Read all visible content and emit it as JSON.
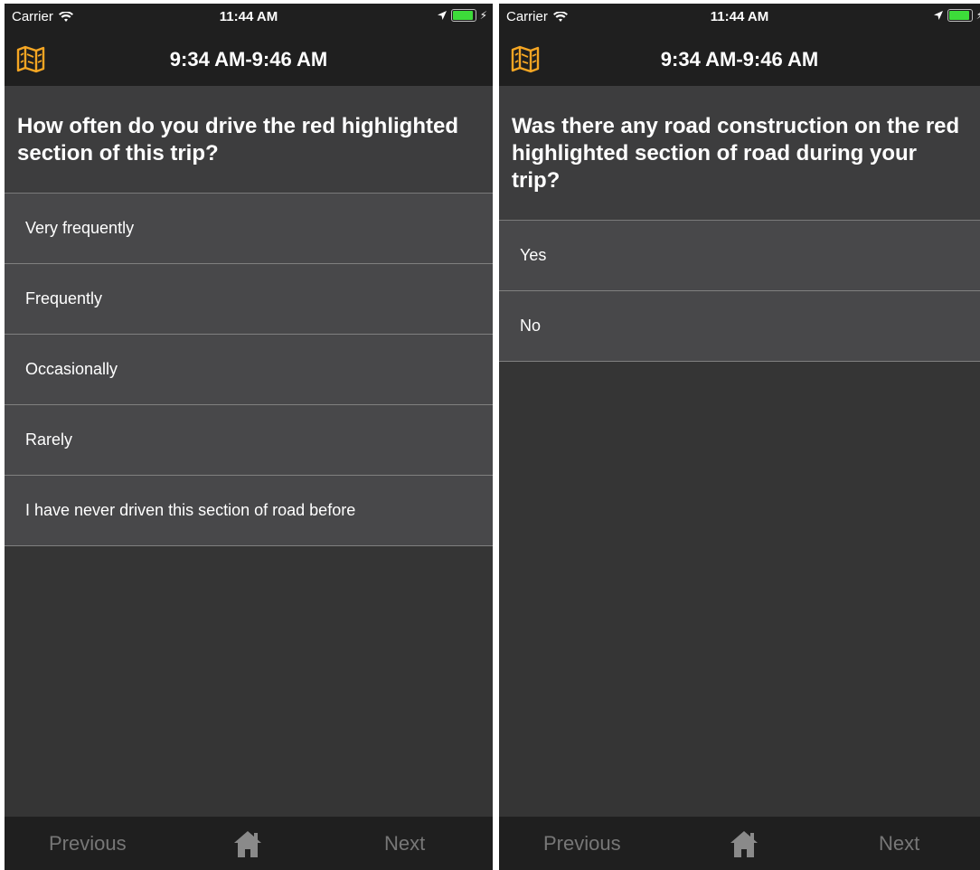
{
  "screens": [
    {
      "status": {
        "carrier": "Carrier",
        "time": "11:44 AM"
      },
      "nav": {
        "title": "9:34 AM-9:46 AM",
        "map_icon": "map-icon"
      },
      "question": "How often do you drive the red highlighted section of this trip?",
      "options": [
        "Very frequently",
        "Frequently",
        "Occasionally",
        "Rarely",
        "I have never driven this section of road before"
      ],
      "footer": {
        "previous": "Previous",
        "next": "Next",
        "home_icon": "home-icon"
      }
    },
    {
      "status": {
        "carrier": "Carrier",
        "time": "11:44 AM"
      },
      "nav": {
        "title": "9:34 AM-9:46 AM",
        "map_icon": "map-icon"
      },
      "question": "Was there any road construction on the red highlighted section of road during your trip?",
      "options": [
        "Yes",
        "No"
      ],
      "footer": {
        "previous": "Previous",
        "next": "Next",
        "home_icon": "home-icon"
      }
    }
  ],
  "colors": {
    "accent": "#f5a623",
    "bar_background": "#1f1f1f",
    "option_background": "#48484a",
    "battery_green": "#3ddc3a"
  }
}
